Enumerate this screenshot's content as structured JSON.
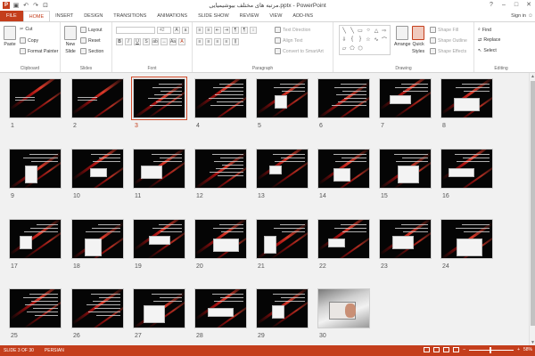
{
  "window": {
    "title": "مرتبه هاى مختلف بيوشيميايى.pptx - PowerPoint",
    "help": "?",
    "minimize": "–",
    "maximize": "□",
    "close": "✕"
  },
  "qat": {
    "save": "▣",
    "undo": "↶",
    "redo": "↷",
    "start": "⊡"
  },
  "tabs": [
    {
      "label": "FILE"
    },
    {
      "label": "HOME"
    },
    {
      "label": "INSERT"
    },
    {
      "label": "DESIGN"
    },
    {
      "label": "TRANSITIONS"
    },
    {
      "label": "ANIMATIONS"
    },
    {
      "label": "SLIDE SHOW"
    },
    {
      "label": "REVIEW"
    },
    {
      "label": "VIEW"
    },
    {
      "label": "ADD-INS"
    }
  ],
  "signin": "Sign in",
  "ribbon": {
    "clipboard": {
      "paste": "Paste",
      "cut": "Cut",
      "copy": "Copy",
      "format_painter": "Format Painter",
      "label": "Clipboard"
    },
    "slides": {
      "new_slide": "New",
      "new_slide2": "Slide",
      "layout": "Layout",
      "reset": "Reset",
      "section": "Section",
      "label": "Slides"
    },
    "font": {
      "font_name": "",
      "font_size": "42",
      "label": "Font"
    },
    "paragraph": {
      "text_direction": "Text Direction",
      "align_text": "Align Text",
      "convert_smartart": "Convert to SmartArt",
      "label": "Paragraph"
    },
    "drawing": {
      "arrange": "Arrange",
      "quick_styles": "Quick",
      "quick_styles2": "Styles",
      "shape_fill": "Shape Fill",
      "shape_outline": "Shape Outline",
      "shape_effects": "Shape Effects",
      "label": "Drawing"
    },
    "editing": {
      "find": "Find",
      "replace": "Replace",
      "select": "Select",
      "label": "Editing"
    }
  },
  "slides": [
    {
      "n": "1"
    },
    {
      "n": "2"
    },
    {
      "n": "3"
    },
    {
      "n": "4"
    },
    {
      "n": "5"
    },
    {
      "n": "6"
    },
    {
      "n": "7"
    },
    {
      "n": "8"
    },
    {
      "n": "9"
    },
    {
      "n": "10"
    },
    {
      "n": "11"
    },
    {
      "n": "12"
    },
    {
      "n": "13"
    },
    {
      "n": "14"
    },
    {
      "n": "15"
    },
    {
      "n": "16"
    },
    {
      "n": "17"
    },
    {
      "n": "18"
    },
    {
      "n": "19"
    },
    {
      "n": "20"
    },
    {
      "n": "21"
    },
    {
      "n": "22"
    },
    {
      "n": "23"
    },
    {
      "n": "24"
    },
    {
      "n": "25"
    },
    {
      "n": "26"
    },
    {
      "n": "27"
    },
    {
      "n": "28"
    },
    {
      "n": "29"
    },
    {
      "n": "30"
    }
  ],
  "selected_slide": 3,
  "status": {
    "slide_info": "SLIDE 3 OF 30",
    "language": "PERSIAN",
    "zoom": "58%",
    "minus": "–",
    "plus": "+"
  },
  "colors": {
    "accent": "#c43e1c",
    "slide_bg": "#050505",
    "sorter_bg": "#f1f1f1"
  }
}
